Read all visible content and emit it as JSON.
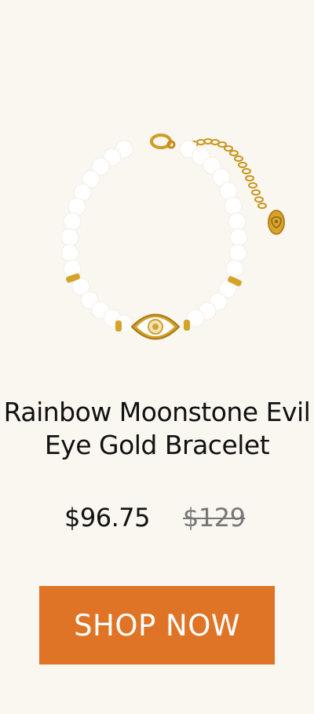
{
  "product": {
    "title_line1": "Rainbow Moonstone Evil",
    "title_line2": "Eye Gold Bracelet",
    "price": "$96.75",
    "original_price": "$129"
  },
  "cta": {
    "label": "SHOP NOW"
  },
  "colors": {
    "background": "#faf7f0",
    "button": "#e07426",
    "gold": "#d4a32b",
    "bead": "#ffffff"
  }
}
